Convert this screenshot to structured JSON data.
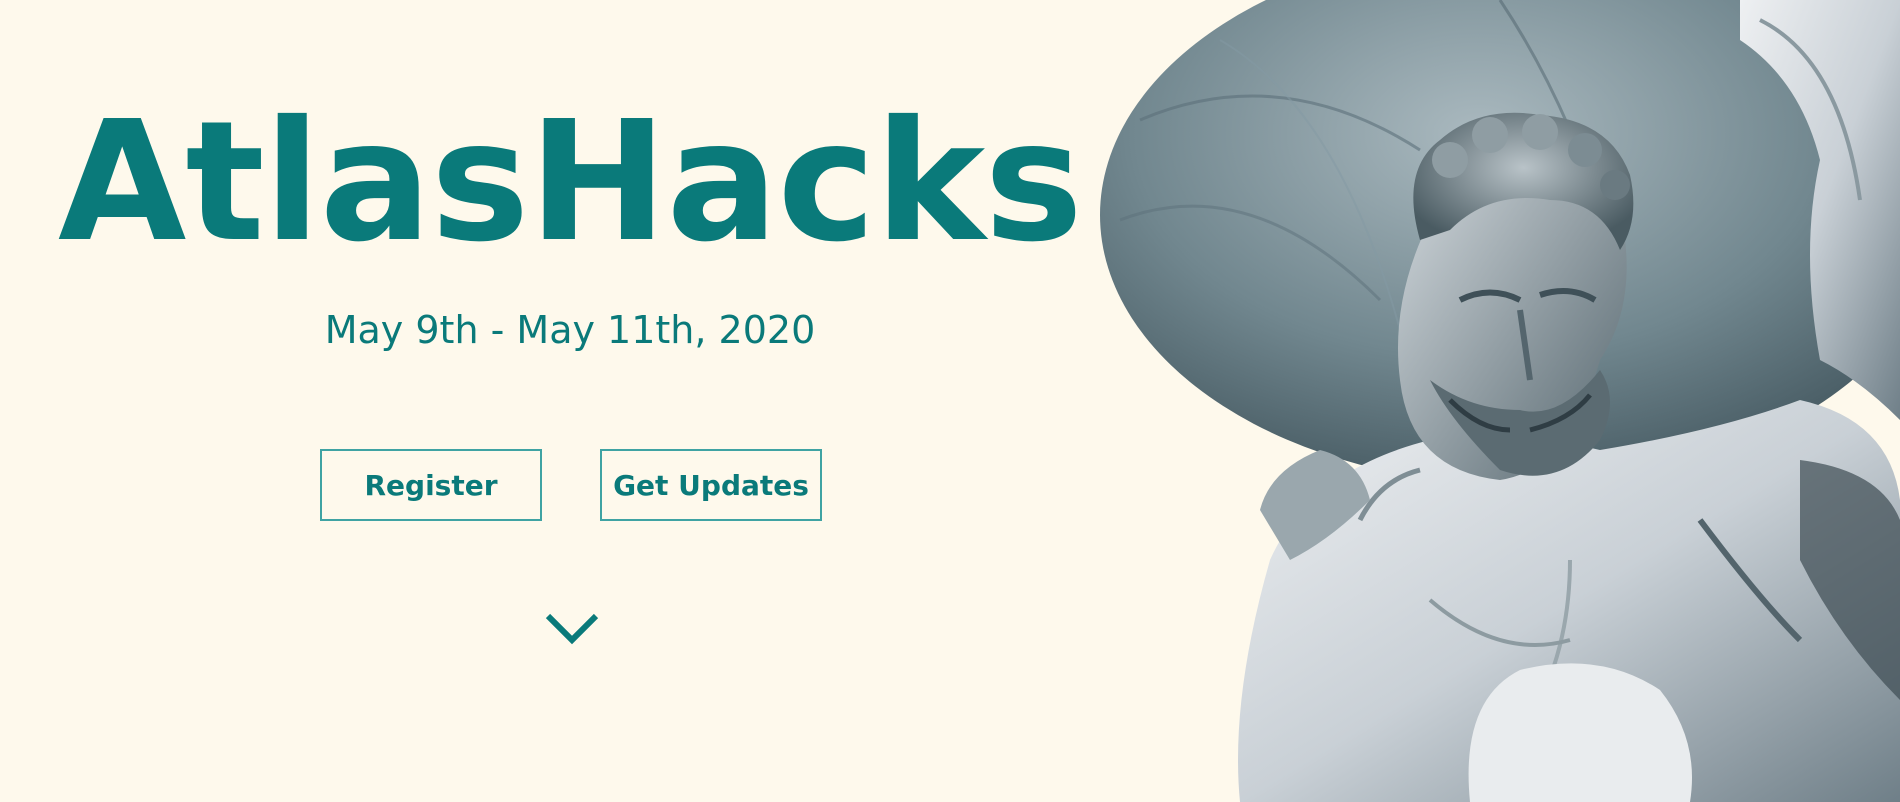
{
  "hero": {
    "title": "AtlasHacks",
    "dates": "May 9th - May 11th, 2020"
  },
  "buttons": {
    "register_label": "Register",
    "updates_label": "Get Updates"
  },
  "icons": {
    "scroll": "chevron-down-icon"
  },
  "colors": {
    "background": "#fef9ec",
    "accent": "#0a7a7a",
    "button_border": "#3fa3a3"
  }
}
